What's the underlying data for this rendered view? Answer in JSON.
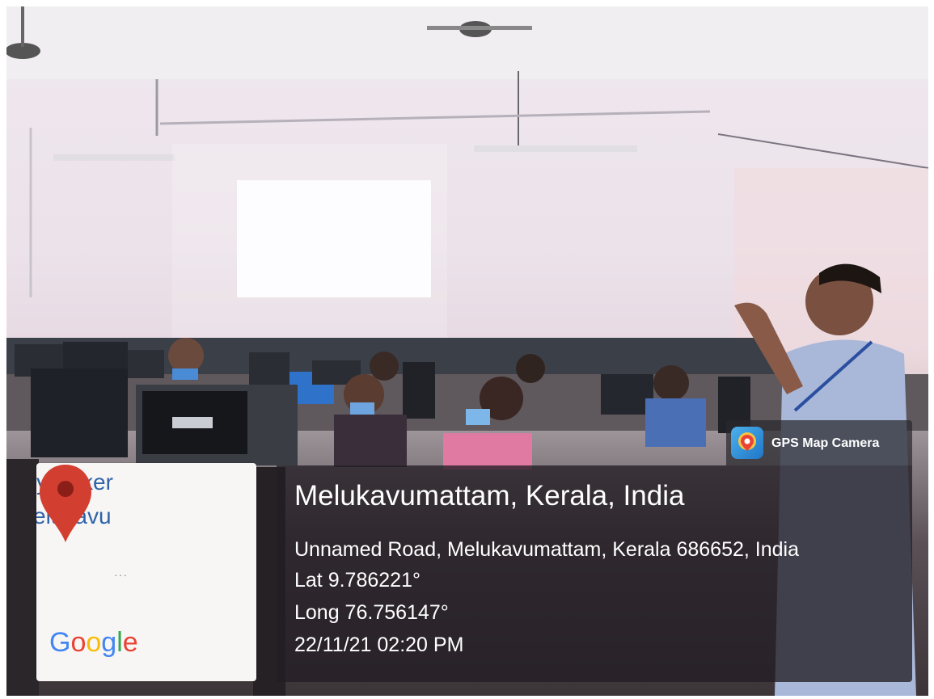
{
  "stamp": {
    "app_name": "GPS Map Camera",
    "place": "Melukavumattam, Kerala, India",
    "address": "Unnamed Road, Melukavumattam, Kerala 686652, India",
    "latitude": "Lat 9.786221°",
    "longitude": "Long 76.756147°",
    "datetime": "22/11/21 02:20 PM"
  },
  "map_thumbnail": {
    "label_line_1": "y Baker",
    "label_line_2": "elukavu",
    "logo_text": "Google",
    "pin_color": "#d23f31"
  },
  "icons": [
    "location-pin-icon",
    "app-icon"
  ]
}
